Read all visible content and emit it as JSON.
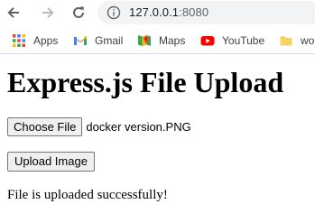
{
  "browser": {
    "url_host": "127.0.0.1",
    "url_port": ":8080",
    "bookmarks": [
      {
        "label": "Apps",
        "icon": "apps-grid-icon"
      },
      {
        "label": "Gmail",
        "icon": "gmail-icon"
      },
      {
        "label": "Maps",
        "icon": "maps-icon"
      },
      {
        "label": "YouTube",
        "icon": "youtube-icon"
      },
      {
        "label": "wo",
        "icon": "folder-icon"
      }
    ]
  },
  "page": {
    "title": "Express.js File Upload",
    "choose_file_label": "Choose File",
    "selected_file": "docker version.PNG",
    "upload_label": "Upload Image",
    "status_message": "File is uploaded successfully!"
  }
}
